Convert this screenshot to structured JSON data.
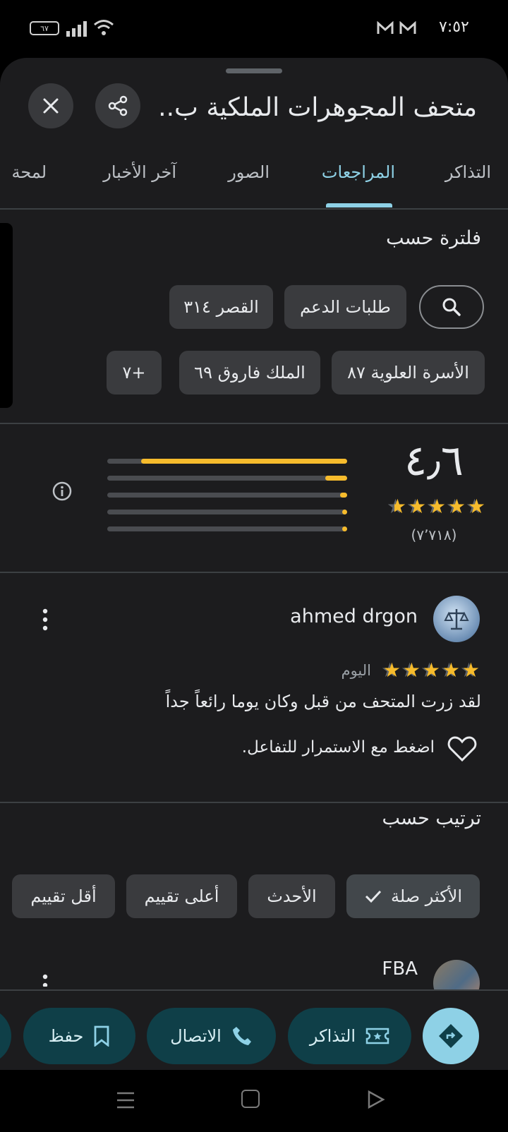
{
  "status_bar": {
    "battery": "٦٧",
    "time": "٧:٥٢",
    "mail_icon": "gmail-icon"
  },
  "header": {
    "title": "متحف المجوهرات الملكية ب..",
    "share_icon": "share-icon",
    "close_icon": "close-icon"
  },
  "tabs": [
    "التذاكر",
    "المراجعات",
    "الصور",
    "آخر الأخبار",
    "لمحة"
  ],
  "active_tab": "المراجعات",
  "filter": {
    "label": "فلترة حسب",
    "chips": [
      "طلبات الدعم",
      "القصر ٣١٤",
      "الأسرة العلوية ٨٧",
      "الملك فاروق ٦٩",
      "+٧"
    ]
  },
  "rating_summary": {
    "score": "٤٫٦",
    "count": "(٧٬٧١٨)",
    "stars": 4.6,
    "distribution": [
      0.86,
      0.09,
      0.03,
      0.01,
      0.01
    ],
    "accent": "#f6bb2c"
  },
  "review": {
    "author": "ahmed drgon",
    "stars": 5,
    "date": "اليوم",
    "text": "لقد زرت المتحف من قبل وكان يوما رائعاً جداً",
    "like_prompt": "اضغط مع الاستمرار للتفاعل."
  },
  "sort": {
    "label": "ترتيب حسب",
    "options": [
      "الأكثر صلة",
      "الأحدث",
      "أعلى تقييم",
      "أقل تقييم"
    ],
    "selected": "الأكثر صلة"
  },
  "next_review": {
    "author": "FBA"
  },
  "actions": {
    "tickets": "التذاكر",
    "call": "الاتصال",
    "save": "حفظ"
  },
  "colors": {
    "accent_teal": "#8ed1e6",
    "pill_bg": "#0f3f48",
    "star": "#f6bb2c"
  }
}
